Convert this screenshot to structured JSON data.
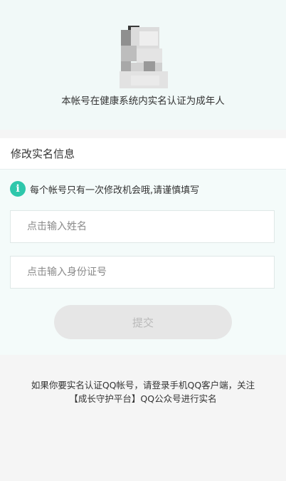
{
  "account_status": "本帐号在健康系统内实名认证为成年人",
  "form": {
    "title": "修改实名信息",
    "notice_icon": "info-icon",
    "notice_icon_glyph": "i",
    "notice_text": "每个帐号只有一次修改机会哦,请谨慎填写",
    "name_placeholder": "点击输入姓名",
    "id_placeholder": "点击输入身份证号",
    "submit_label": "提交"
  },
  "footer": {
    "line1": "如果你要实名认证QQ帐号，请登录手机QQ客户端，关注",
    "line2": "【成长守护平台】QQ公众号进行实名"
  },
  "colors": {
    "accent": "#2ec7ab",
    "top_background": "#f1f9f8",
    "submit_disabled": "#e6e6e6"
  }
}
